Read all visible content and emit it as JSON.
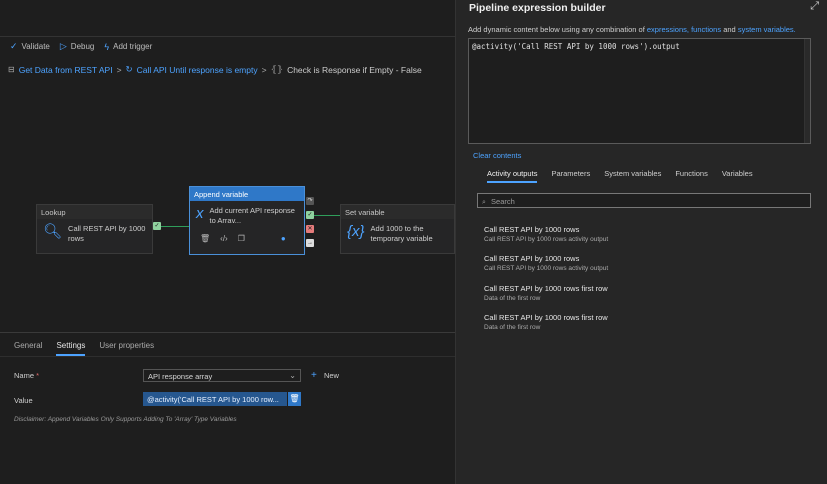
{
  "toolbar": {
    "validate": "Validate",
    "debug": "Debug",
    "add_trigger": "Add trigger"
  },
  "breadcrumb": {
    "item1": "Get Data from REST API",
    "item2": "Call API Until response is empty",
    "item3": "Check is Response if Empty - False"
  },
  "canvas": {
    "lookup": {
      "header": "Lookup",
      "label": "Call REST API by 1000 rows"
    },
    "append": {
      "header": "Append variable",
      "label": "Add current API response to Arrav..."
    },
    "setvar": {
      "header": "Set variable",
      "label": "Add 1000 to the temporary variable"
    }
  },
  "bottom": {
    "tabs": [
      "General",
      "Settings",
      "User properties"
    ],
    "name_label": "Name",
    "name_required": "*",
    "name_value": "API response array",
    "new_label": "New",
    "value_label": "Value",
    "value_text": "@activity('Call REST API by 1000 row...",
    "disclaimer": "Disclaimer: Append Variables Only Supports Adding To 'Array' Type Variables"
  },
  "builder": {
    "title": "Pipeline expression builder",
    "desc_prefix": "Add dynamic content below using any combination of",
    "desc_link1": "expressions,",
    "desc_link2": "functions",
    "desc_and": "and",
    "desc_link3": "system variables.",
    "expression": "@activity('Call REST API by 1000 rows').output",
    "clear": "Clear contents",
    "tabs": [
      "Activity outputs",
      "Parameters",
      "System variables",
      "Functions",
      "Variables"
    ],
    "search_placeholder": "Search",
    "outputs": [
      {
        "title": "Call REST API by 1000 rows",
        "sub": "Call REST API by 1000 rows activity output"
      },
      {
        "title": "Call REST API by 1000 rows",
        "sub": "Call REST API by 1000 rows activity output"
      },
      {
        "title": "Call REST API by 1000 rows first row",
        "sub": "Data of the first row"
      },
      {
        "title": "Call REST API by 1000 rows first row",
        "sub": "Data of the first row"
      }
    ]
  },
  "colors": {
    "accent": "#4da3ff",
    "selected": "#2f78c8",
    "success": "#2f9e5a"
  }
}
